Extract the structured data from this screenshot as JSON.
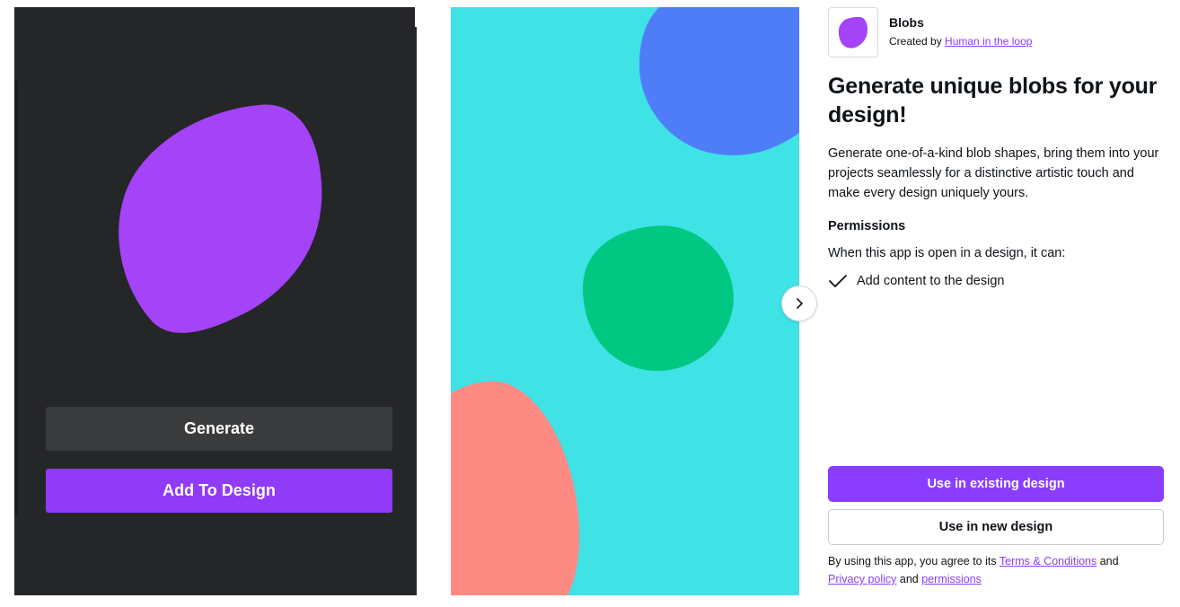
{
  "preview_left": {
    "generate_label": "Generate",
    "add_label": "Add To Design",
    "blob_color": "#a443f8"
  },
  "preview_middle": {
    "background_color": "#3fe2e5",
    "blob_colors": [
      "#4f7df8",
      "#00c882",
      "#fe8a84"
    ]
  },
  "carousel": {
    "next_icon": "chevron-right-icon"
  },
  "app": {
    "icon": "blob-icon",
    "name": "Blobs",
    "created_by_prefix": "Created by",
    "creator": "Human in the loop",
    "headline": "Generate unique blobs for your design!",
    "description": "Generate one-of-a-kind blob shapes, bring them into your projects seamlessly for a distinctive artistic touch and make every design uniquely yours.",
    "permissions_title": "Permissions",
    "permissions_intro": "When this app is open in a design, it can:",
    "permissions": [
      {
        "icon": "check-icon",
        "label": "Add content to the design"
      }
    ]
  },
  "actions": {
    "existing_label": "Use in existing design",
    "new_label": "Use in new design"
  },
  "terms": {
    "prefix": "By using this app, you agree to its",
    "terms_link": "Terms & Conditions",
    "and1": "and",
    "privacy_link": "Privacy policy",
    "and2": "and",
    "permissions_link": "permissions"
  },
  "colors": {
    "accent": "#8b3dff",
    "dark_panel": "#252627",
    "text": "#0e1318"
  }
}
